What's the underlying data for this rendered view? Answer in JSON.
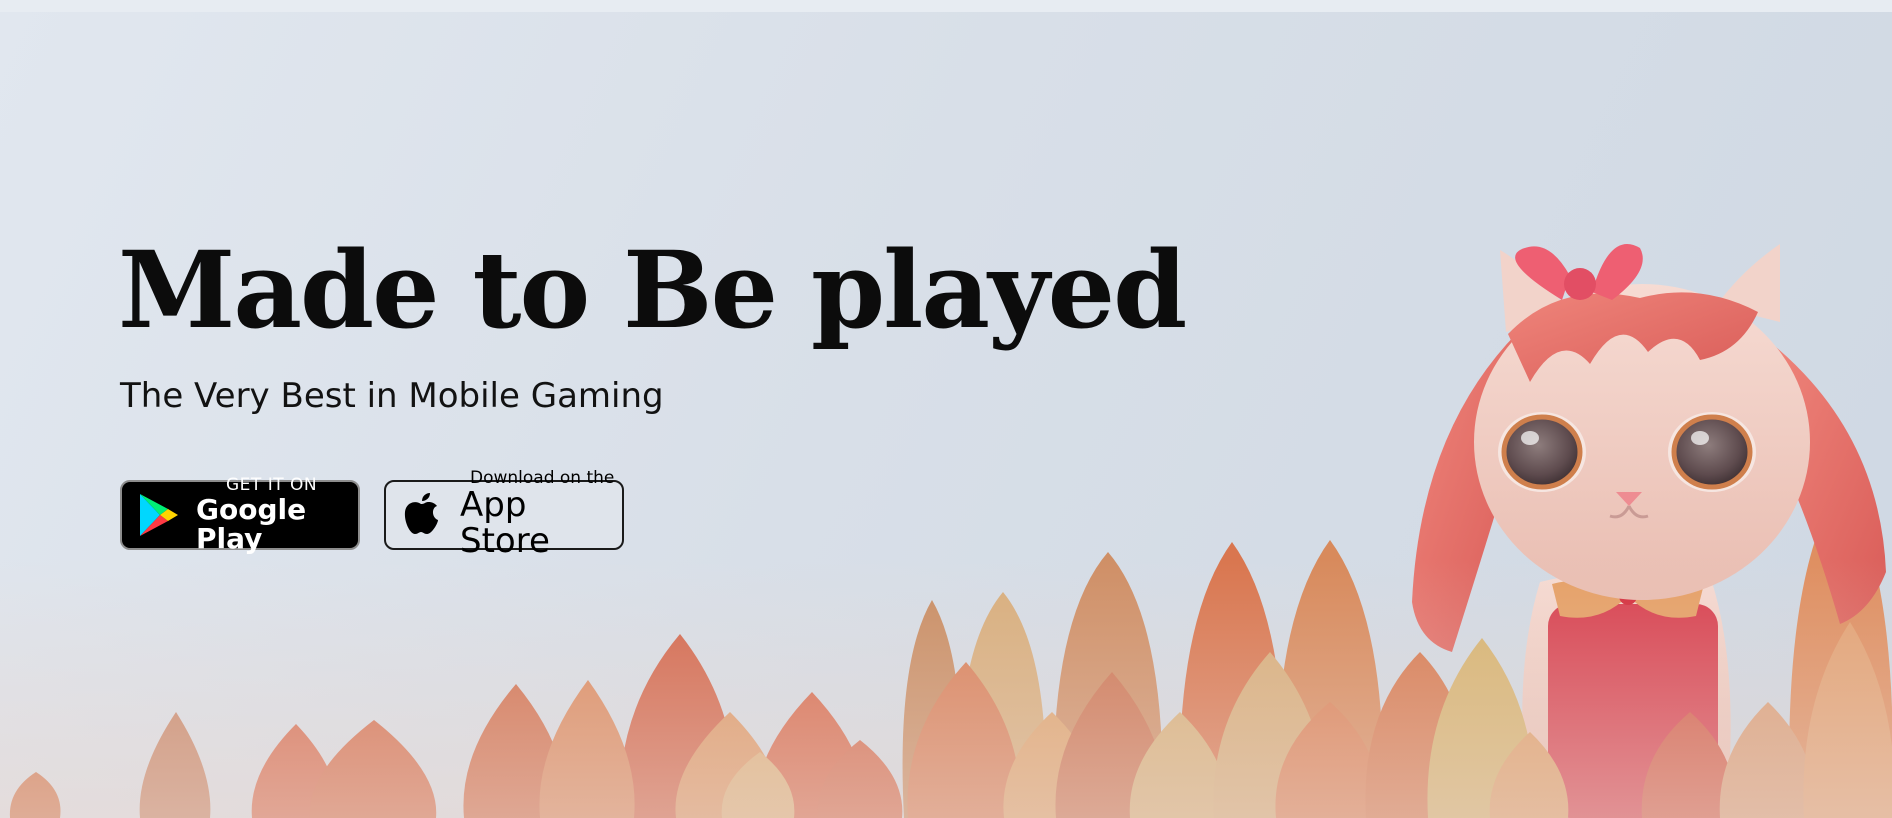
{
  "hero": {
    "title": "Made to Be played",
    "subtitle": "The Very Best in Mobile Gaming"
  },
  "store_buttons": {
    "google_play": {
      "small_label": "GET IT ON",
      "big_label": "Google Play",
      "icon": "google-play-icon"
    },
    "app_store": {
      "small_label": "Download on the",
      "big_label": "App Store",
      "icon": "apple-icon"
    }
  },
  "illustration": {
    "subject": "cat-character",
    "bow_icon": "bow-icon"
  },
  "colors": {
    "title_text": "#0c0c0c",
    "background": "#dde3eb",
    "leaf_red": "#d4694d",
    "leaf_orange": "#dc8b5a",
    "leaf_tan": "#d9ab73",
    "cat_fur": "#f1cfc6",
    "cat_hair": "#e7746c",
    "bow": "#ee5f72",
    "dress": "#d8404f"
  }
}
